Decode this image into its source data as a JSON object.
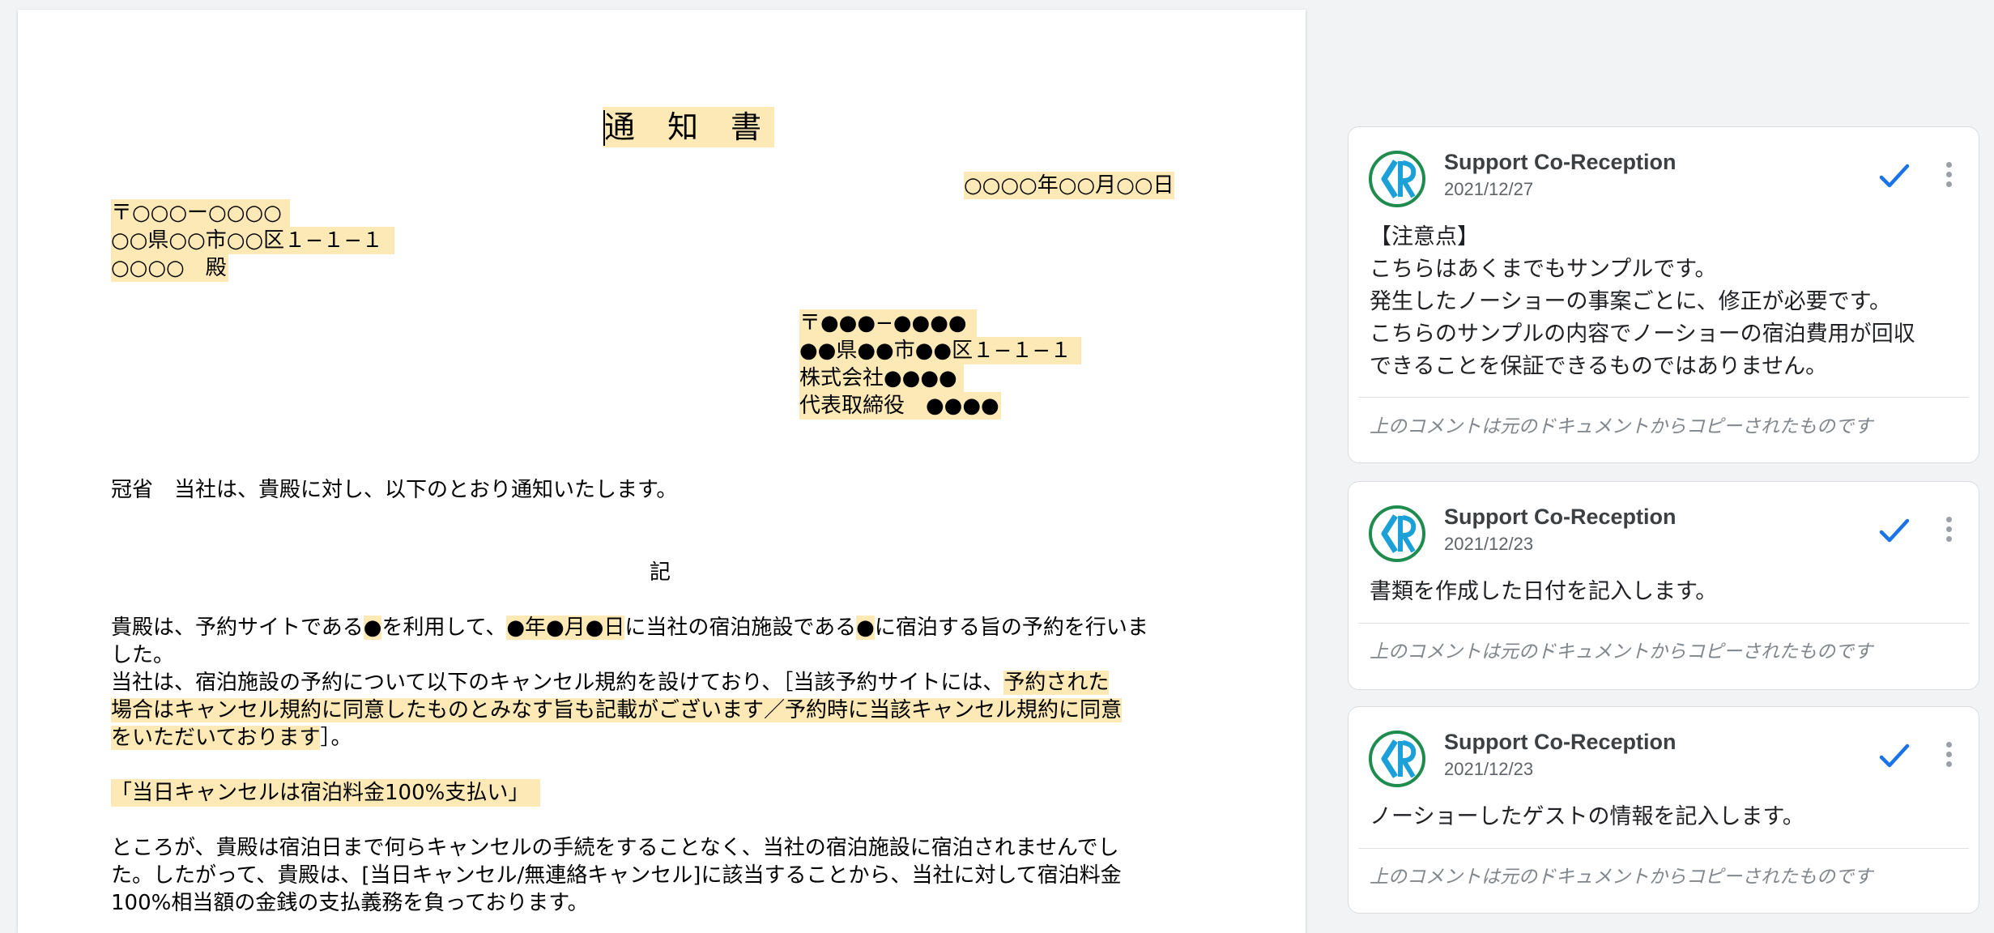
{
  "document": {
    "title": "通 知 書",
    "date": "○○○○年○○月○○日",
    "recipient": {
      "postal": "〒○○○ー○○○○",
      "address": "○○県○○市○○区１−１−１",
      "name": "○○○○　殿"
    },
    "sender": {
      "postal": "〒●●●−●●●●",
      "address": "●●県●●市●●区１−１−１",
      "company": "株式会社●●●●",
      "representative": "代表取締役　●●●●"
    },
    "greeting": "冠省　当社は、貴殿に対し、以下のとおり通知いたします。",
    "ki": "記",
    "p1": {
      "a": "貴殿は、予約サイトである",
      "b": "●",
      "c": "を利用して、",
      "d": "●年●月●日",
      "e": "に当社の宿泊施設である",
      "f": "●",
      "g": "に宿泊する旨の予約を行いま",
      "h": "した。"
    },
    "p2": {
      "a": "当社は、宿泊施設の予約について以下のキャンセル規約を設けており、［当該予約サイトには、",
      "b": "予約された",
      "c": "場合はキャンセル規約に同意したものとみなす旨も記載がございます／予約時に当該キャンセル規約に同意",
      "d": "をいただいております",
      "e": "］。"
    },
    "rule": "「当日キャンセルは宿泊料金100%支払い」",
    "p3": {
      "l1": "ところが、貴殿は宿泊日まで何らキャンセルの手続をすることなく、当社の宿泊施設に宿泊されませんでし",
      "l2": "た。したがって、貴殿は、[当日キャンセル/無連絡キャンセル]に該当することから、当社に対して宿泊料金",
      "l3": "100%相当額の金銭の支払義務を負っております。"
    }
  },
  "comments": [
    {
      "author": "Support Co-Reception",
      "date": "2021/12/27",
      "lines": [
        "【注意点】",
        "こちらはあくまでもサンプルです。",
        "発生したノーショーの事案ごとに、修正が必要です。",
        "こちらのサンプルの内容でノーショーの宿泊費用が回収",
        "できることを保証できるものではありません。"
      ],
      "footer": "上のコメントは元のドキュメントからコピーされたものです"
    },
    {
      "author": "Support Co-Reception",
      "date": "2021/12/23",
      "lines": [
        "書類を作成した日付を記入します。"
      ],
      "footer": "上のコメントは元のドキュメントからコピーされたものです"
    },
    {
      "author": "Support Co-Reception",
      "date": "2021/12/23",
      "lines": [
        "ノーショーしたゲストの情報を記入します。"
      ],
      "footer": "上のコメントは元のドキュメントからコピーされたものです"
    }
  ],
  "icons": {
    "avatar": "support-co-reception-logo",
    "resolve": "check-icon",
    "more": "more-vert-icon"
  },
  "colors": {
    "highlight": "#fde9b5",
    "check": "#1a73e8",
    "logo_green": "#1e8c4e",
    "logo_blue": "#1ba1d8"
  }
}
